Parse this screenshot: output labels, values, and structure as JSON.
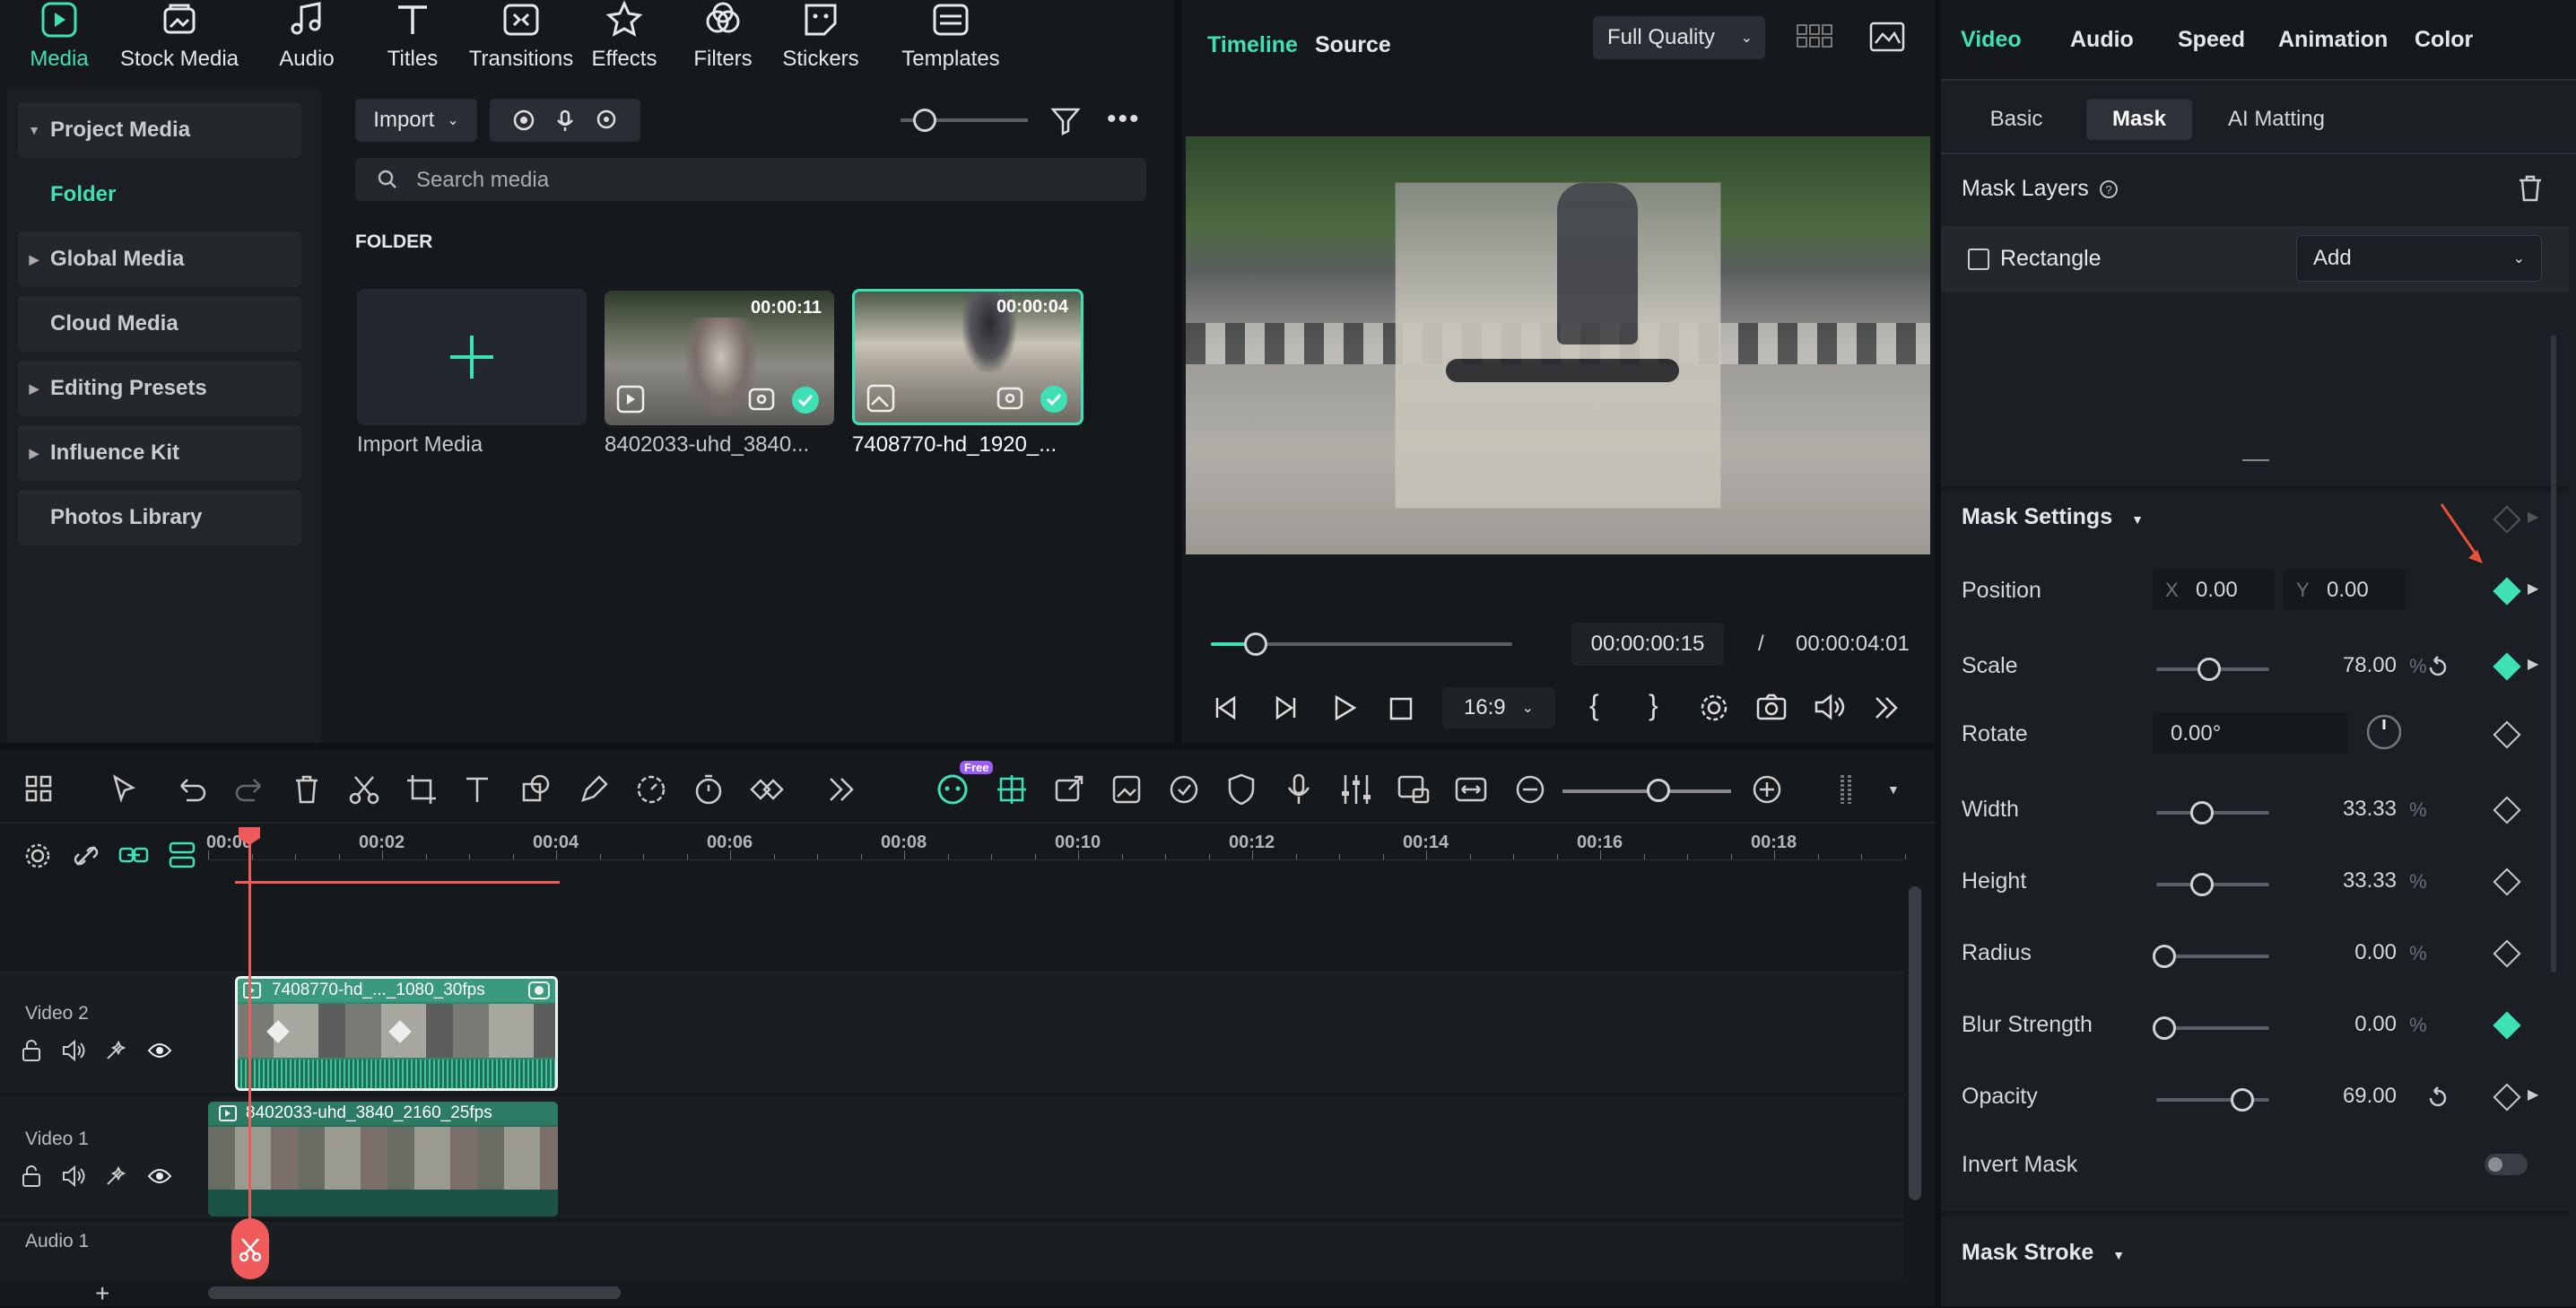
{
  "top_tabs": [
    {
      "label": "Media",
      "icon": "media-icon",
      "active": true
    },
    {
      "label": "Stock Media",
      "icon": "stock-media-icon"
    },
    {
      "label": "Audio",
      "icon": "audio-icon"
    },
    {
      "label": "Titles",
      "icon": "titles-icon"
    },
    {
      "label": "Transitions",
      "icon": "transitions-icon"
    },
    {
      "label": "Effects",
      "icon": "effects-icon"
    },
    {
      "label": "Filters",
      "icon": "filters-icon"
    },
    {
      "label": "Stickers",
      "icon": "stickers-icon"
    },
    {
      "label": "Templates",
      "icon": "templates-icon"
    }
  ],
  "sidebar": {
    "items": [
      {
        "label": "Project Media",
        "expandable": true
      },
      {
        "label": "Folder",
        "active": true
      },
      {
        "label": "Global Media",
        "expandable": true
      },
      {
        "label": "Cloud Media"
      },
      {
        "label": "Editing Presets",
        "expandable": true
      },
      {
        "label": "Influence Kit",
        "expandable": true
      },
      {
        "label": "Photos Library"
      }
    ]
  },
  "media_toolbar": {
    "import_label": "Import",
    "search_placeholder": "Search media",
    "folder_heading": "FOLDER"
  },
  "media_items": [
    {
      "label": "Import Media"
    },
    {
      "label": "8402033-uhd_3840...",
      "duration": "00:00:11"
    },
    {
      "label": "7408770-hd_1920_...",
      "duration": "00:00:04",
      "selected": true
    }
  ],
  "preview": {
    "tab_timeline": "Timeline",
    "tab_source": "Source",
    "quality": "Full Quality",
    "current_time": "00:00:00:15",
    "separator": "/",
    "total_time": "00:00:04:01",
    "aspect": "16:9",
    "progress": 0.15
  },
  "inspector": {
    "tabs": [
      "Video",
      "Audio",
      "Speed",
      "Animation",
      "Color"
    ],
    "active_tab": "Video",
    "subtabs": [
      "Basic",
      "Mask",
      "AI Matting"
    ],
    "active_subtab": "Mask",
    "mask_layers_label": "Mask Layers",
    "rectangle_label": "Rectangle",
    "add_label": "Add",
    "mask_settings_label": "Mask Settings",
    "position_label": "Position",
    "pos_x_label": "X",
    "pos_x": "0.00",
    "pos_y_label": "Y",
    "pos_y": "0.00",
    "rows": [
      {
        "label": "Scale",
        "value": "78.00",
        "unit": "%",
        "level": 0.4,
        "reset": true,
        "kf_on": true,
        "arrow": true
      },
      {
        "label": "Width",
        "value": "33.33",
        "unit": "%",
        "level": 0.33,
        "reset": false,
        "kf_on": false,
        "arrow": false
      },
      {
        "label": "Height",
        "value": "33.33",
        "unit": "%",
        "level": 0.33,
        "reset": false,
        "kf_on": false,
        "arrow": false
      },
      {
        "label": "Radius",
        "value": "0.00",
        "unit": "%",
        "level": 0.0,
        "reset": false,
        "kf_on": false,
        "arrow": false
      },
      {
        "label": "Blur Strength",
        "value": "0.00",
        "unit": "%",
        "level": 0.0,
        "reset": false,
        "kf_on": true,
        "arrow": false
      },
      {
        "label": "Opacity",
        "value": "69.00",
        "unit": "",
        "level": 0.69,
        "reset": true,
        "kf_on": false,
        "arrow": true
      }
    ],
    "rotate_label": "Rotate",
    "rotate_value": "0.00°",
    "invert_label": "Invert Mask",
    "mask_stroke_label": "Mask Stroke"
  },
  "timeline": {
    "ticks": [
      "00:00",
      "00:02",
      "00:04",
      "00:06",
      "00:08",
      "00:10",
      "00:12",
      "00:14",
      "00:16",
      "00:18"
    ],
    "free_badge": "Free",
    "tracks": [
      {
        "name": "Video 2",
        "clip": "7408770-hd_..._1080_30fps"
      },
      {
        "name": "Video 1",
        "clip": "8402033-uhd_3840_2160_25fps"
      },
      {
        "name": "Audio 1"
      }
    ]
  },
  "colors": {
    "accent": "#3ee0b6",
    "playhead": "#f05a5a",
    "arrow": "#e8503a"
  }
}
